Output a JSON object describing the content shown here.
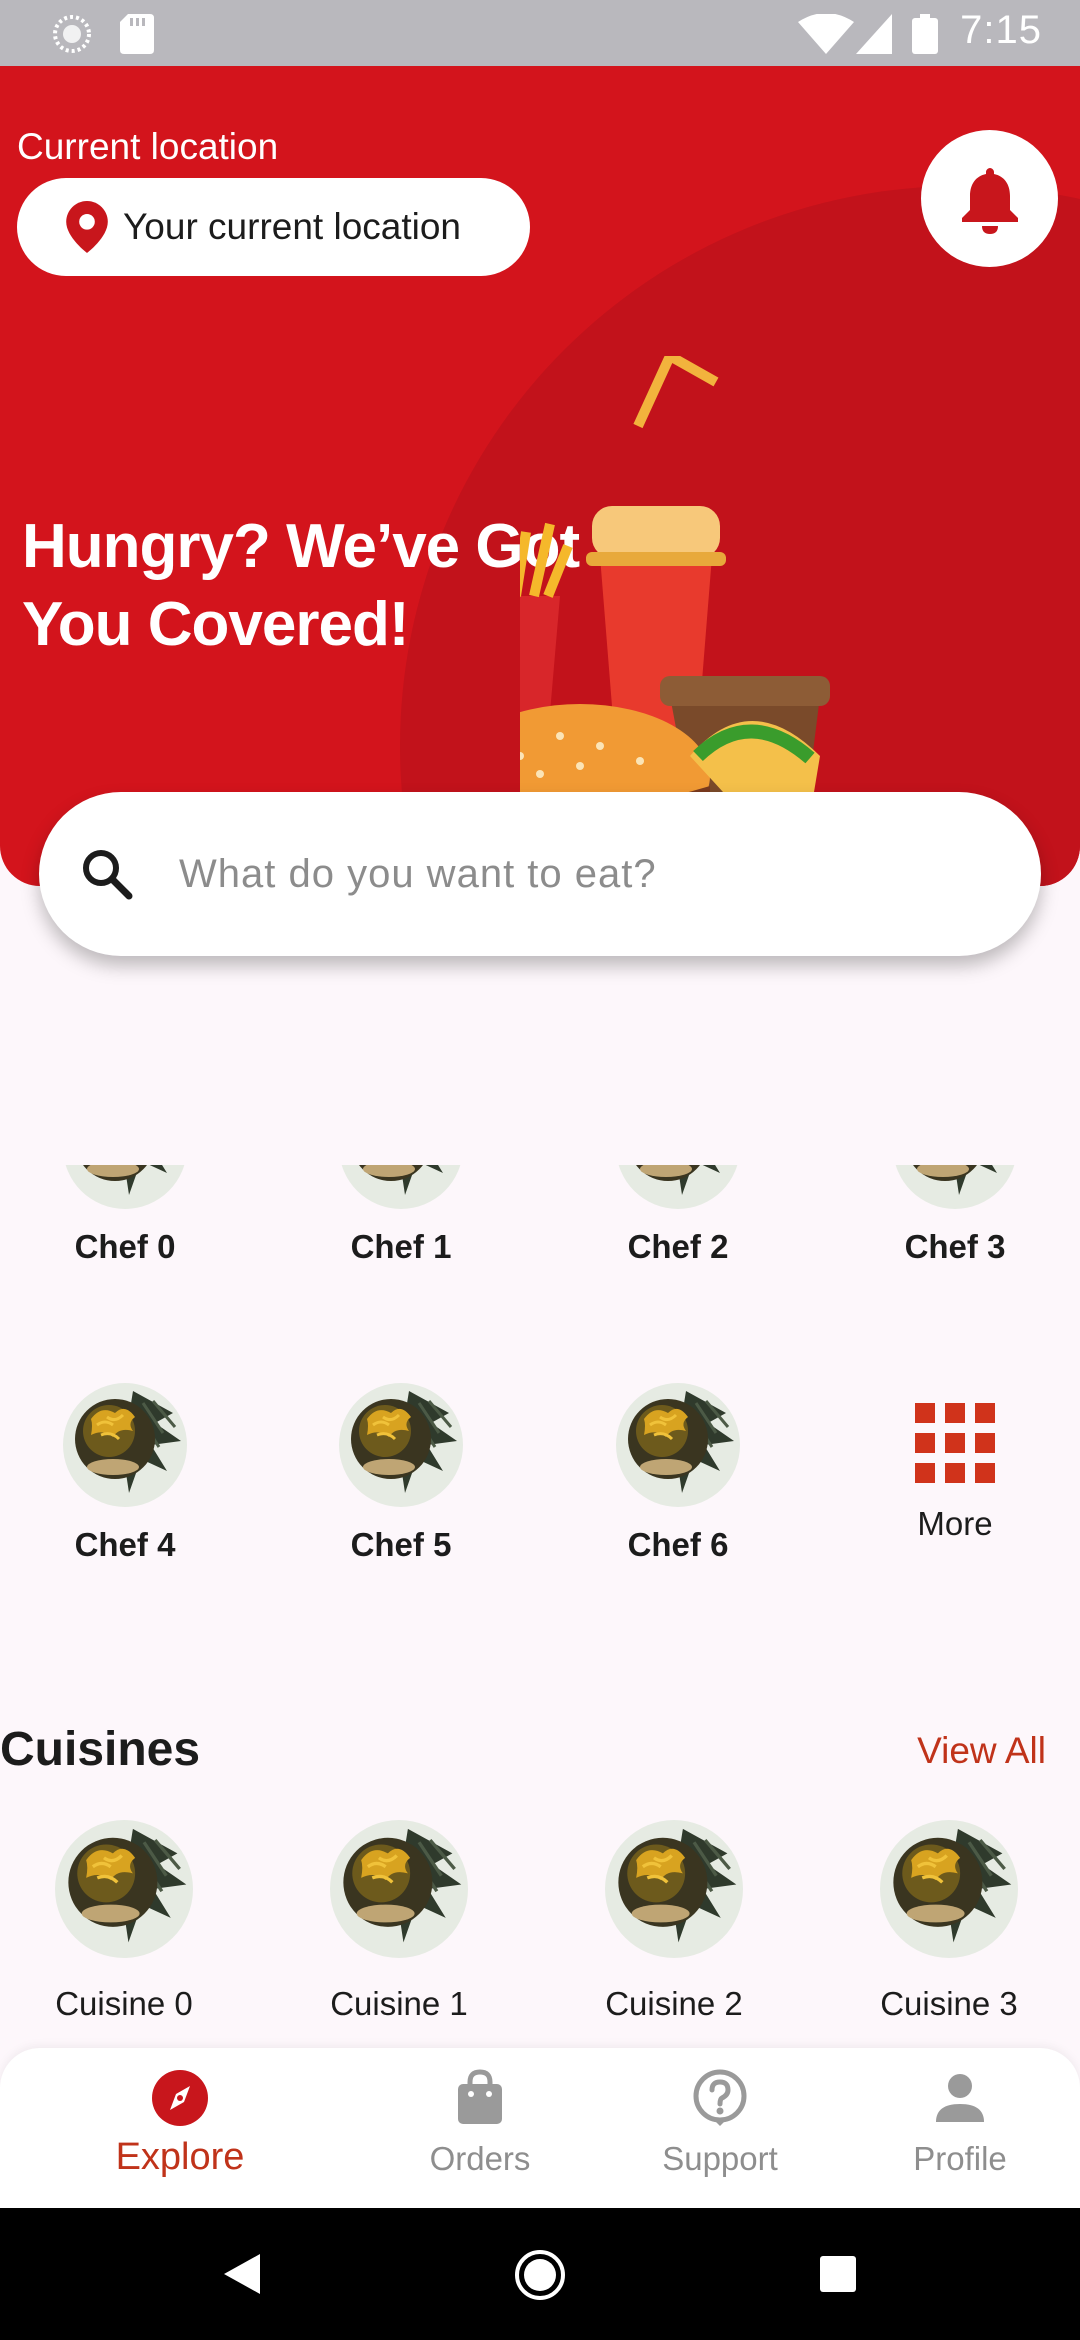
{
  "status_bar": {
    "time": "7:15"
  },
  "header": {
    "location_label": "Current location",
    "location_value": "Your current location",
    "hero_line1": "Hungry? We’ve Got",
    "hero_line2": "You Covered!"
  },
  "search": {
    "placeholder": "What do you want to eat?"
  },
  "chefs": {
    "items": [
      {
        "label": "Chef 0"
      },
      {
        "label": "Chef 1"
      },
      {
        "label": "Chef 2"
      },
      {
        "label": "Chef 3"
      },
      {
        "label": "Chef 4"
      },
      {
        "label": "Chef 5"
      },
      {
        "label": "Chef 6"
      }
    ],
    "more_label": "More"
  },
  "cuisines": {
    "title": "Cuisines",
    "view_all": "View All",
    "items": [
      {
        "label": "Cuisine 0"
      },
      {
        "label": "Cuisine 1"
      },
      {
        "label": "Cuisine 2"
      },
      {
        "label": "Cuisine 3"
      }
    ]
  },
  "bottom_nav": {
    "items": [
      {
        "label": "Explore",
        "icon": "compass-icon",
        "active": true
      },
      {
        "label": "Orders",
        "icon": "shopping-bag-icon",
        "active": false
      },
      {
        "label": "Support",
        "icon": "help-circle-icon",
        "active": false
      },
      {
        "label": "Profile",
        "icon": "person-icon",
        "active": false
      }
    ]
  },
  "colors": {
    "primary": "#d3141c",
    "accent": "#c0331a",
    "background": "#fdf7fb"
  }
}
